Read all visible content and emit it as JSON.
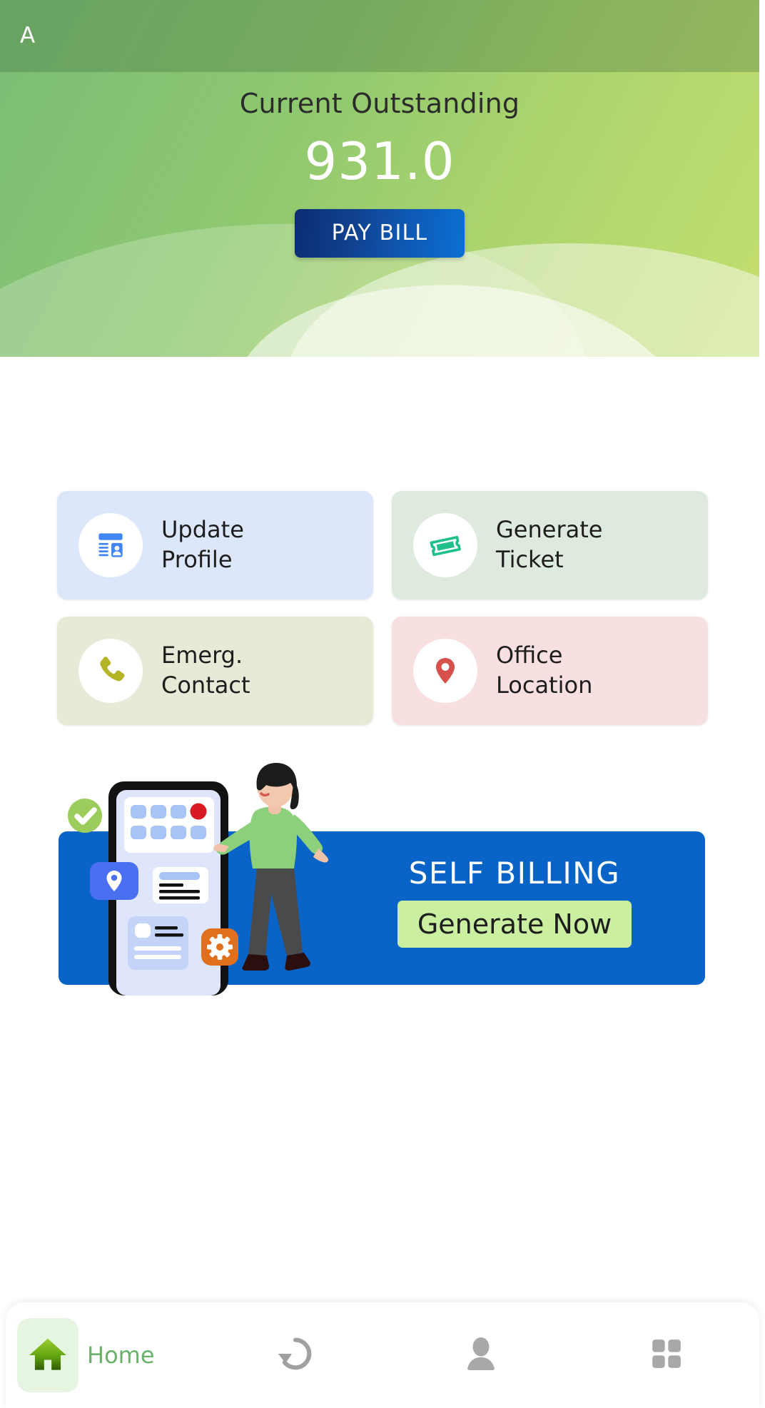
{
  "topbar": {
    "avatar_letter": "A"
  },
  "hero": {
    "label": "Current Outstanding",
    "amount": "931.0",
    "pay_button": "PAY BILL",
    "accent_blue": "#0a64c8",
    "green_start": "#7bbd77",
    "green_end": "#c4df6e"
  },
  "actions": [
    {
      "label": "Update\nProfile",
      "icon": "profile-card-icon",
      "bg": "#dce7fb",
      "icon_color": "#4285f4"
    },
    {
      "label": "Generate\nTicket",
      "icon": "ticket-icon",
      "bg": "#dfeade",
      "icon_color": "#20c08a"
    },
    {
      "label": "Emerg.\nContact",
      "icon": "phone-icon",
      "bg": "#e8e9d7",
      "icon_color": "#b5b427"
    },
    {
      "label": "Office\nLocation",
      "icon": "map-pin-icon",
      "bg": "#f8dfe0",
      "icon_color": "#d6504c"
    }
  ],
  "banner": {
    "title": "SELF BILLING",
    "cta": "Generate Now",
    "bg": "#0a64c8",
    "cta_bg": "#caefa0"
  },
  "bottom_nav": [
    {
      "label": "Home",
      "icon": "home-icon",
      "active": true
    },
    {
      "label": "",
      "icon": "refresh-history-icon",
      "active": false
    },
    {
      "label": "",
      "icon": "person-icon",
      "active": false
    },
    {
      "label": "",
      "icon": "grid-apps-icon",
      "active": false
    }
  ]
}
